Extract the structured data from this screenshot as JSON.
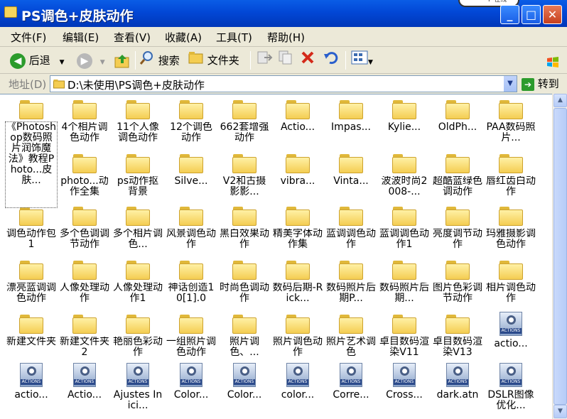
{
  "window": {
    "title": "PS调色+皮肤动作",
    "msn_badge": "P 在线"
  },
  "menu": [
    "文件(F)",
    "编辑(E)",
    "查看(V)",
    "收藏(A)",
    "工具(T)",
    "帮助(H)"
  ],
  "toolbar": {
    "back": "后退",
    "search": "搜索",
    "folders": "文件夹"
  },
  "address": {
    "label": "地址(D)",
    "path": "D:\\未使用\\PS调色+皮肤动作",
    "go": "转到"
  },
  "items": [
    [
      "《Photoshop数码照片润饰魔法》教程Photo...皮肤...",
      "folder"
    ],
    [
      "4个相片调色动作",
      "folder"
    ],
    [
      "11个人像调色动作",
      "folder"
    ],
    [
      "12个调色动作",
      "folder"
    ],
    [
      "662套增强动作",
      "folder"
    ],
    [
      "Actio...",
      "folder"
    ],
    [
      "Impas...",
      "folder"
    ],
    [
      "Kylie...",
      "folder"
    ],
    [
      "OldPh...",
      "folder"
    ],
    [
      "PAA数码照片...",
      "folder"
    ],
    [
      "",
      "folder"
    ],
    [
      "photo...动作全集",
      "folder"
    ],
    [
      "ps动作抠背景",
      "folder"
    ],
    [
      "Silve...",
      "folder"
    ],
    [
      "V2和古摄影影...",
      "folder"
    ],
    [
      "vibra...",
      "folder"
    ],
    [
      "Vinta...",
      "folder"
    ],
    [
      "波波时尚2008-...",
      "folder"
    ],
    [
      "超酷蓝绿色调动作",
      "folder"
    ],
    [
      "唇红齿白动作",
      "folder"
    ],
    [
      "调色动作包1",
      "folder"
    ],
    [
      "多个色调调节动作",
      "folder"
    ],
    [
      "多个相片调色...",
      "folder"
    ],
    [
      "风景调色动作",
      "folder"
    ],
    [
      "黑白效果动作",
      "folder"
    ],
    [
      "精美字体动作集",
      "folder"
    ],
    [
      "蓝调调色动作",
      "folder"
    ],
    [
      "蓝调调色动作1",
      "folder"
    ],
    [
      "亮度调节动作",
      "folder"
    ],
    [
      "玛雅摄影调色动作",
      "folder"
    ],
    [
      "漂亮蓝调调色动作",
      "folder"
    ],
    [
      "人像处理动作",
      "folder"
    ],
    [
      "人像处理动作1",
      "folder"
    ],
    [
      "神话创造10[1].0",
      "folder"
    ],
    [
      "时尚色调动作",
      "folder"
    ],
    [
      "数码后期-Rick...",
      "folder"
    ],
    [
      "数码照片后期P...",
      "folder"
    ],
    [
      "数码照片后期...",
      "folder"
    ],
    [
      "图片色彩调节动作",
      "folder"
    ],
    [
      "相片调色动作",
      "folder"
    ],
    [
      "新建文件夹",
      "folder"
    ],
    [
      "新建文件夹2",
      "folder"
    ],
    [
      "艳丽色彩动作",
      "folder"
    ],
    [
      "一组照片调色动作",
      "folder"
    ],
    [
      "照片调色、...",
      "folder"
    ],
    [
      "照片调色动作",
      "folder"
    ],
    [
      "照片艺术调色",
      "folder"
    ],
    [
      "卓目数码渲染V11",
      "folder"
    ],
    [
      "卓目数码渲染V13",
      "folder"
    ],
    [
      "actio...",
      "action"
    ],
    [
      "actio...",
      "action"
    ],
    [
      "Actio...",
      "action"
    ],
    [
      "Ajustes Inici...",
      "action"
    ],
    [
      "Color...",
      "action"
    ],
    [
      "Color...",
      "action"
    ],
    [
      "color...",
      "action"
    ],
    [
      "Corre...",
      "action"
    ],
    [
      "Cross...",
      "action"
    ],
    [
      "dark.atn",
      "action"
    ],
    [
      "DSLR图像优化...",
      "action"
    ]
  ],
  "action_badge": "ACTIONS"
}
